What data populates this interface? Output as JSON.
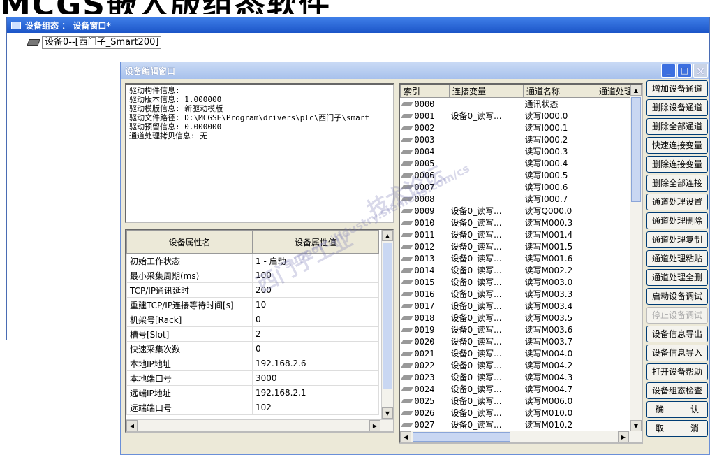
{
  "background_title": "MCGS嵌入版组态软件",
  "outer_window": {
    "title": "设备组态 ： 设备窗口*"
  },
  "tree": {
    "item_label": "设备0--[西门子_Smart200]"
  },
  "dialog": {
    "title": "设备编辑窗口"
  },
  "info_lines": [
    "驱动构件信息:",
    "驱动版本信息: 1.000000",
    "驱动模版信息: 新驱动模版",
    "驱动文件路径: D:\\MCGSE\\Program\\drivers\\plc\\西门子\\smart",
    "驱动预留信息: 0.000000",
    "通道处理拷贝信息: 无"
  ],
  "props": {
    "headers": [
      "设备属性名",
      "设备属性值"
    ],
    "rows": [
      [
        "初始工作状态",
        "1 - 启动"
      ],
      [
        "最小采集周期(ms)",
        "100"
      ],
      [
        "TCP/IP通讯延时",
        "200"
      ],
      [
        "重建TCP/IP连接等待时间[s]",
        "10"
      ],
      [
        "机架号[Rack]",
        "0"
      ],
      [
        "槽号[Slot]",
        "2"
      ],
      [
        "快速采集次数",
        "0"
      ],
      [
        "本地IP地址",
        "192.168.2.6"
      ],
      [
        "本地端口号",
        "3000"
      ],
      [
        "远端IP地址",
        "192.168.2.1"
      ],
      [
        "远端端口号",
        "102"
      ]
    ]
  },
  "channels": {
    "headers": [
      "索引",
      "连接变量",
      "通道名称",
      "通道处理"
    ],
    "rows": [
      [
        "0000",
        "",
        "通讯状态"
      ],
      [
        "0001",
        "设备0_读写...",
        "读写I000.0"
      ],
      [
        "0002",
        "",
        "读写I000.1"
      ],
      [
        "0003",
        "",
        "读写I000.2"
      ],
      [
        "0004",
        "",
        "读写I000.3"
      ],
      [
        "0005",
        "",
        "读写I000.4"
      ],
      [
        "0006",
        "",
        "读写I000.5"
      ],
      [
        "0007",
        "",
        "读写I000.6"
      ],
      [
        "0008",
        "",
        "读写I000.7"
      ],
      [
        "0009",
        "设备0_读写...",
        "读写Q000.0"
      ],
      [
        "0010",
        "设备0_读写...",
        "读写M000.3"
      ],
      [
        "0011",
        "设备0_读写...",
        "读写M001.4"
      ],
      [
        "0012",
        "设备0_读写...",
        "读写M001.5"
      ],
      [
        "0013",
        "设备0_读写...",
        "读写M001.6"
      ],
      [
        "0014",
        "设备0_读写...",
        "读写M002.2"
      ],
      [
        "0015",
        "设备0_读写...",
        "读写M003.0"
      ],
      [
        "0016",
        "设备0_读写...",
        "读写M003.3"
      ],
      [
        "0017",
        "设备0_读写...",
        "读写M003.4"
      ],
      [
        "0018",
        "设备0_读写...",
        "读写M003.5"
      ],
      [
        "0019",
        "设备0_读写...",
        "读写M003.6"
      ],
      [
        "0020",
        "设备0_读写...",
        "读写M003.7"
      ],
      [
        "0021",
        "设备0_读写...",
        "读写M004.0"
      ],
      [
        "0022",
        "设备0_读写...",
        "读写M004.2"
      ],
      [
        "0023",
        "设备0_读写...",
        "读写M004.3"
      ],
      [
        "0024",
        "设备0_读写...",
        "读写M004.7"
      ],
      [
        "0025",
        "设备0_读写...",
        "读写M006.0"
      ],
      [
        "0026",
        "设备0_读写...",
        "读写M010.0"
      ],
      [
        "0027",
        "设备0_读写...",
        "读写M010.2"
      ]
    ]
  },
  "buttons": {
    "add_channel": "增加设备通道",
    "delete_channel": "删除设备通道",
    "delete_all_channels": "删除全部通道",
    "quick_connect": "快速连接变量",
    "delete_connect": "删除连接变量",
    "delete_all_connect": "删除全部连接",
    "channel_proc_setting": "通道处理设置",
    "channel_proc_delete": "通道处理删除",
    "channel_proc_copy": "通道处理复制",
    "channel_proc_paste": "通道处理粘贴",
    "channel_proc_delete_all": "通道处理全删",
    "start_debug": "启动设备调试",
    "stop_debug": "停止设备调试",
    "export_info": "设备信息导出",
    "import_info": "设备信息导入",
    "open_help": "打开设备帮助",
    "check_config": "设备组态检查",
    "confirm_a": "确",
    "confirm_b": "认",
    "cancel_a": "取",
    "cancel_b": "消"
  },
  "watermark": [
    "西门子工业",
    "技术论坛",
    "support.industry.siemens.com/cs"
  ]
}
